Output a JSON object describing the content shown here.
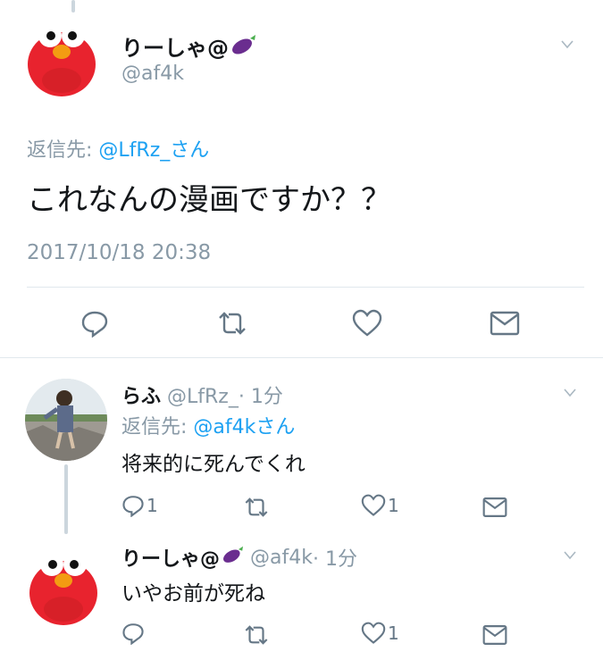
{
  "main_tweet": {
    "display_name": "りーしゃ@",
    "handle": "@af4k",
    "reply_prefix": "返信先:",
    "reply_target": "@LfRz_さん",
    "text": "これなんの漫画ですか？？",
    "timestamp": "2017/10/18 20:38"
  },
  "replies": [
    {
      "display_name": "らふ",
      "handle": "@LfRz_",
      "time": "· 1分",
      "reply_prefix": "返信先:",
      "reply_target": "@af4kさん",
      "text": "将来的に死んでくれ",
      "reply_count": "1",
      "like_count": "1"
    },
    {
      "display_name": "りーしゃ@",
      "handle": "@af4k",
      "time": "· 1分",
      "text": "いやお前が死ね",
      "like_count": "1"
    }
  ],
  "icons": [
    "avatar-elmo",
    "avatar-photo",
    "eggplant-emoji",
    "chevron-down-icon",
    "reply-icon",
    "retweet-icon",
    "like-icon",
    "message-icon"
  ],
  "colors": {
    "muted": "#8899a6",
    "link": "#1da1f2",
    "icon": "#657786",
    "divider": "#e1e8ed",
    "avatar_red": "#e8232e"
  }
}
